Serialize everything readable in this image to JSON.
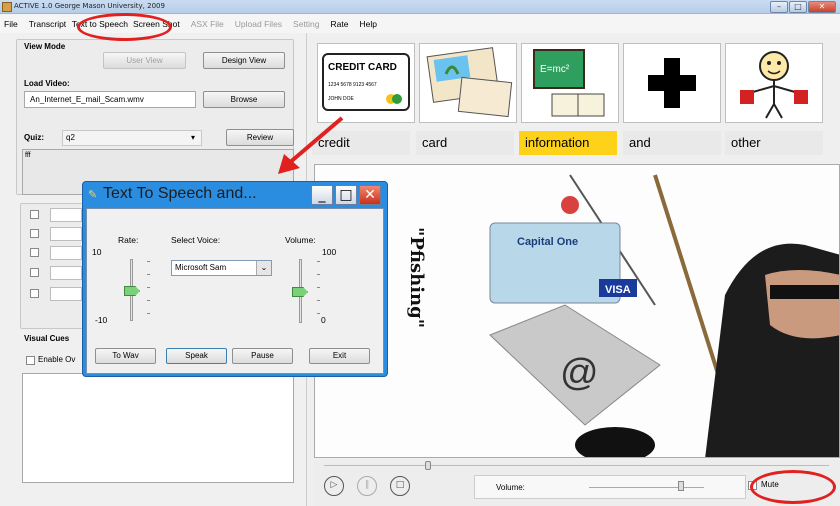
{
  "window": {
    "title": "ACTIVE 1.0 George Mason University, 2009"
  },
  "menu": [
    {
      "label": "File",
      "enabled": true
    },
    {
      "label": "Transcript",
      "enabled": true
    },
    {
      "label": "Text to Speech",
      "enabled": true
    },
    {
      "label": "Screen Shot",
      "enabled": true
    },
    {
      "label": "ASX File",
      "enabled": false
    },
    {
      "label": "Upload Files",
      "enabled": false
    },
    {
      "label": "Setting",
      "enabled": false
    },
    {
      "label": "Rate",
      "enabled": true
    },
    {
      "label": "Help",
      "enabled": true
    }
  ],
  "left": {
    "view_mode": {
      "label": "View Mode",
      "user_view": "User View",
      "design_view": "Design View"
    },
    "load_video": {
      "label": "Load Video:",
      "file": "An_Internet_E_mail_Scam.wmv",
      "browse": "Browse"
    },
    "quiz": {
      "label": "Quiz:",
      "value": "q2",
      "review": "Review",
      "text": "fff"
    },
    "visual_cues": {
      "label": "Visual Cues",
      "enable": "Enable Ov"
    }
  },
  "symbols": [
    {
      "caption": "credit",
      "icon": "credit-card-icon",
      "highlight": false
    },
    {
      "caption": "card",
      "icon": "postcard-icon",
      "highlight": false
    },
    {
      "caption": "information",
      "icon": "chalkboard-book-icon",
      "highlight": true
    },
    {
      "caption": "and",
      "icon": "plus-icon",
      "highlight": false
    },
    {
      "caption": "other",
      "icon": "person-icon",
      "highlight": false
    }
  ],
  "credit_card": {
    "title": "CREDIT CARD",
    "number": "1234 5678 9123 4567",
    "name": "JOHN DOE"
  },
  "board_text": "E=mc²",
  "video": {
    "text": "\"Pfishing\"",
    "card_bank": "Capital One",
    "card_brand": "VISA",
    "email_symbol": "@"
  },
  "dialog": {
    "title": "Text To Speech and...",
    "rate_label": "Rate:",
    "rate_max": "10",
    "rate_min": "-10",
    "voice_label": "Select Voice:",
    "voice": "Microsoft Sam",
    "volume_label": "Volume:",
    "volume_max": "100",
    "volume_min": "0",
    "to_wav": "To Wav",
    "speak": "Speak",
    "pause": "Pause",
    "exit": "Exit"
  },
  "controls": {
    "volume_label": "Volume:",
    "mute": "Mute"
  },
  "colors": {
    "highlight": "#ffd21a",
    "annotation": "#e12020",
    "dialog_frame": "#2a8de0"
  }
}
